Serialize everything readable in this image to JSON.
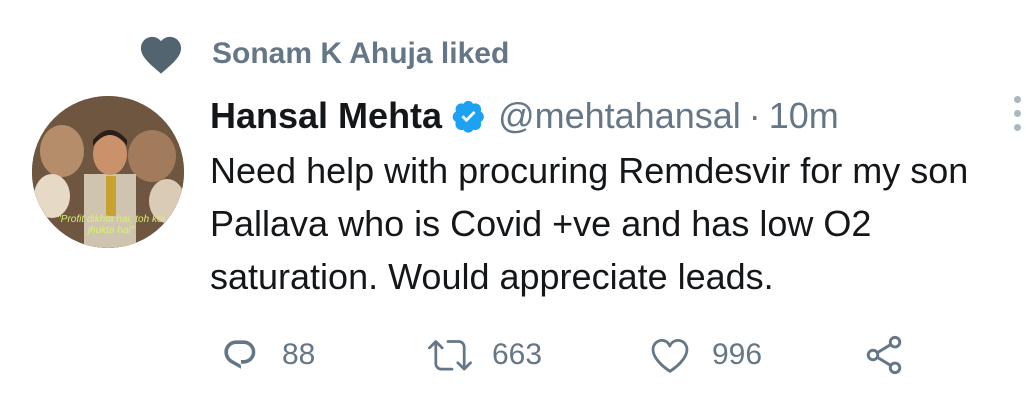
{
  "social_context": {
    "text": "Sonam K Ahuja liked",
    "icon": "heart-icon"
  },
  "avatar": {
    "caption": "\"Profit dikhta hai, toh koi jhukta hai\""
  },
  "tweet": {
    "author_name": "Hansal Mehta",
    "verified_icon": "verified-badge-icon",
    "handle": "@mehtahansal",
    "separator": "·",
    "time": "10m",
    "text": "Need help with procuring Remdesvir for my son Pallava who is Covid +ve and has low O2 saturation. Would appreciate leads."
  },
  "actions": {
    "reply": {
      "icon": "reply-icon",
      "count": "88"
    },
    "retweet": {
      "icon": "retweet-icon",
      "count": "663"
    },
    "like": {
      "icon": "like-icon",
      "count": "996"
    },
    "share": {
      "icon": "share-icon"
    }
  },
  "colors": {
    "secondary": "#657786",
    "primary_text": "#14171a",
    "verified": "#1da1f2"
  }
}
